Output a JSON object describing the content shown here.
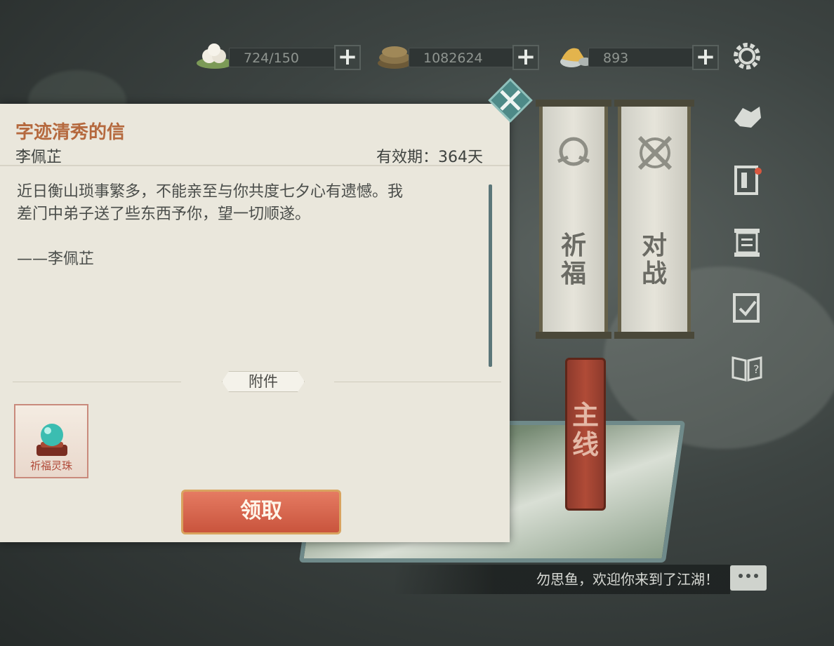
{
  "resources": [
    {
      "icon": "steamed-bun-icon",
      "value": "724/150"
    },
    {
      "icon": "copper-coins-icon",
      "value": "1082624"
    },
    {
      "icon": "gold-ingot-icon",
      "value": "893"
    }
  ],
  "plus_label": "+",
  "side_icons": [
    "settings-icon",
    "handshake-icon",
    "door-icon",
    "scroll-list-icon",
    "task-checklist-icon",
    "guide-book-icon"
  ],
  "scrolls": [
    {
      "label": "祈\n福"
    },
    {
      "label": "对\n战"
    }
  ],
  "main_banner": "主\n线",
  "chat": {
    "message": "勿思鱼，欢迎你来到了江湖！"
  },
  "letter": {
    "title": "字迹清秀的信",
    "sender": "李佩芷",
    "validity": "有效期：364天",
    "body": "近日衡山琐事繁多，不能亲至与你共度七夕心有遗憾。我\n差门中弟子送了些东西予你，望一切顺遂。\n\n——李佩芷",
    "attachments_label": "附件",
    "items": [
      {
        "name": "祈福灵珠",
        "icon": "crystal-orb-icon"
      }
    ],
    "claim_label": "领取"
  },
  "colors": {
    "title": "#b5693e",
    "claim": "#d9654b",
    "panel": "#eae7dc"
  }
}
